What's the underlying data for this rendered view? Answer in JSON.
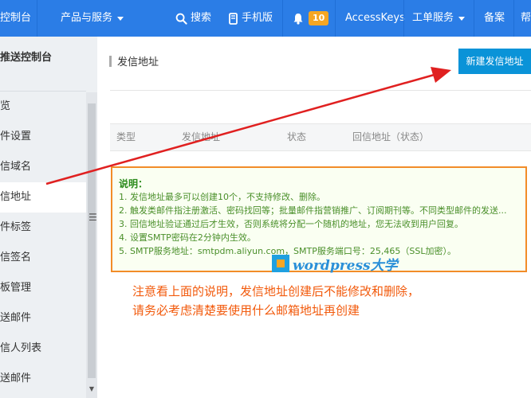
{
  "topbar": {
    "console_label": "控制台",
    "products_label": "产品与服务",
    "search_label": "搜索",
    "mobile_label": "手机版",
    "notification_count": "10",
    "accesskeys_label": "AccessKeys",
    "ticket_label": "工单服务",
    "beian_label": "备案",
    "help_label": "帮"
  },
  "sidebar": {
    "title": "推送控制台",
    "items": [
      {
        "label": "览"
      },
      {
        "label": "件设置"
      },
      {
        "label": "信域名"
      },
      {
        "label": "信地址"
      },
      {
        "label": "件标签"
      },
      {
        "label": "信签名"
      },
      {
        "label": "板管理"
      },
      {
        "label": "送邮件"
      },
      {
        "label": "信人列表"
      },
      {
        "label": "送邮件"
      }
    ],
    "collapse_glyph": "☰",
    "scroll_down_glyph": "▼"
  },
  "main": {
    "page_title": "发信地址",
    "new_button_label": "新建发信地址",
    "table_headers": [
      "类型",
      "发信地址",
      "状态",
      "回信地址（状态）"
    ]
  },
  "notice": {
    "title": "说明：",
    "lines": [
      "1. 发信地址最多可以创建10个，不支持修改、删除。",
      "2. 触发类邮件指注册激活、密码找回等；批量邮件指营销推广、订阅期刊等。不同类型邮件的发送...",
      "3. 回信地址验证通过后才生效，否则系统将分配一个随机的地址，您无法收到用户回复。",
      "4. 设置SMTP密码在2分钟内生效。",
      "5. SMTP服务地址：smtpdm.aliyun.com，SMTP服务端口号：25,465（SSL加密）。"
    ]
  },
  "watermark": {
    "text": "wordpress大学"
  },
  "annotation": {
    "line1": "注意看上面的说明，发信地址创建后不能修改和删除，",
    "line2": "请务必考虑清楚要使用什么邮箱地址再创建"
  },
  "colors": {
    "topbar": "#2b7de6",
    "primary_button": "#0a93d8",
    "notice_border": "#f28c28",
    "notice_text": "#4a8f2a",
    "annotation_text": "#f25a0c",
    "arrow": "#e02020",
    "badge": "#f5a623"
  },
  "icons": {
    "search": "search-icon",
    "mobile": "mobile-icon",
    "bell": "bell-icon",
    "caret": "chevron-down-icon"
  }
}
